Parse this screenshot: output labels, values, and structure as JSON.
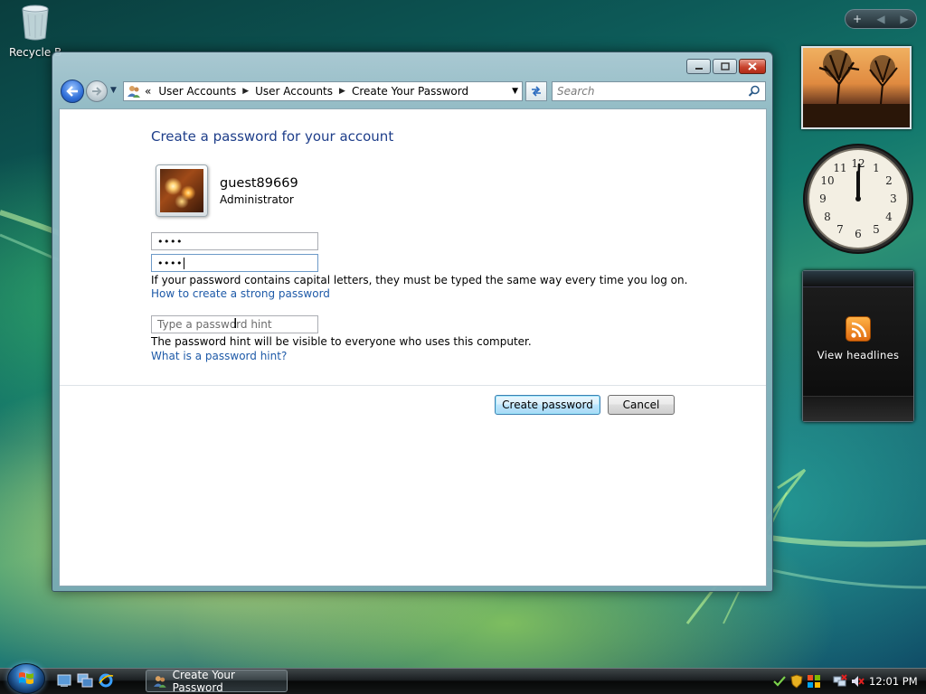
{
  "desktop": {
    "recycle_bin_label": "Recycle Bin"
  },
  "window": {
    "address_bar": {
      "lead": "«",
      "crumbs": [
        "User Accounts",
        "User Accounts",
        "Create Your Password"
      ]
    },
    "search": {
      "placeholder": "Search"
    }
  },
  "content": {
    "title": "Create a password for your account",
    "user": {
      "name": "guest89669",
      "role": "Administrator"
    },
    "new_password": {
      "value": "••••"
    },
    "confirm_password": {
      "value": "••••"
    },
    "caps_note": "If your password contains capital letters, they must be typed the same way every time you log on.",
    "strong_link": "How to create a strong password",
    "hint": {
      "placeholder": "Type a password hint"
    },
    "hint_note": "The password hint will be visible to everyone who uses this computer.",
    "hint_link": "What is a password hint?",
    "buttons": {
      "create": "Create password",
      "cancel": "Cancel"
    }
  },
  "sidebar": {
    "controls": [
      "+",
      "◀",
      "▶"
    ],
    "clock_numbers": [
      "12",
      "1",
      "2",
      "3",
      "4",
      "5",
      "6",
      "7",
      "8",
      "9",
      "10",
      "11"
    ],
    "rss_label": "View headlines"
  },
  "taskbar": {
    "task_label": "Create Your Password",
    "clock": "12:01 PM"
  }
}
